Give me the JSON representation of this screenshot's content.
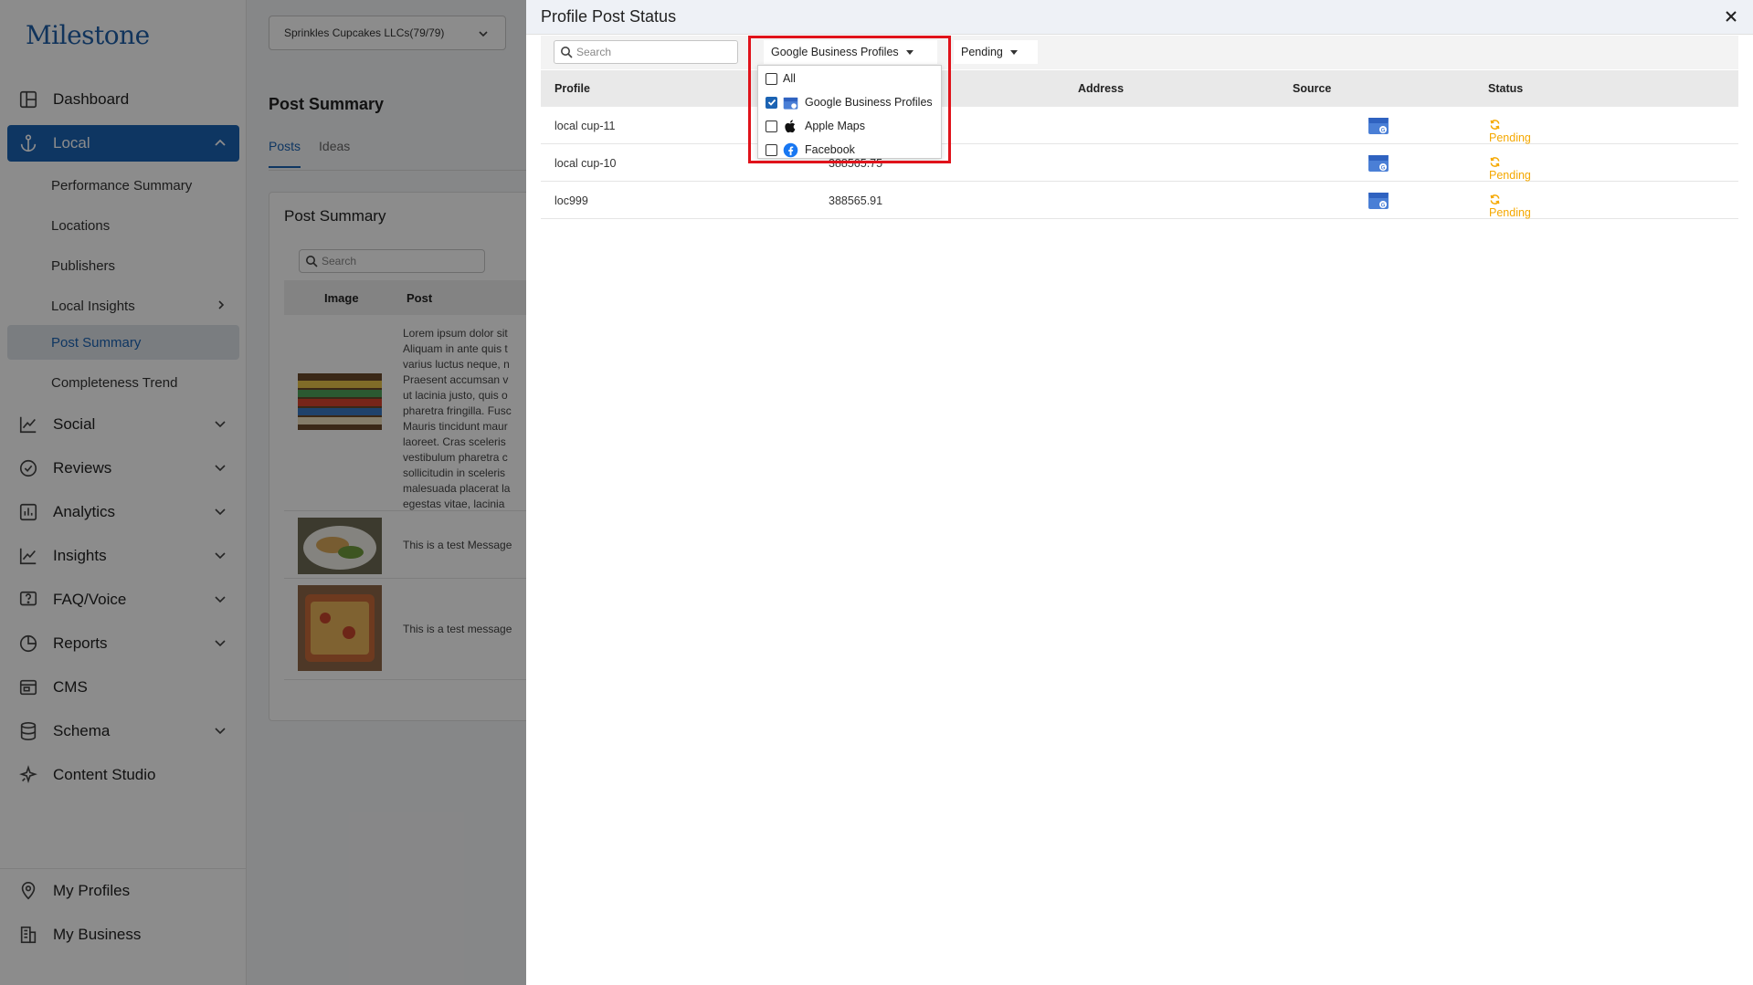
{
  "app": {
    "logo": "Milestone"
  },
  "sidebar": {
    "items": [
      {
        "label": "Dashboard",
        "icon": "dashboard-icon"
      },
      {
        "label": "Local",
        "icon": "anchor-icon"
      },
      {
        "label": "Social",
        "icon": "chart-line-icon"
      },
      {
        "label": "Reviews",
        "icon": "check-circle-icon"
      },
      {
        "label": "Analytics",
        "icon": "bar-chart-icon"
      },
      {
        "label": "Insights",
        "icon": "chart-line-icon"
      },
      {
        "label": "FAQ/Voice",
        "icon": "question-icon"
      },
      {
        "label": "Reports",
        "icon": "pie-chart-icon"
      },
      {
        "label": "CMS",
        "icon": "cms-icon"
      },
      {
        "label": "Schema",
        "icon": "database-icon"
      },
      {
        "label": "Content Studio",
        "icon": "sparkle-icon"
      }
    ],
    "local_sub": [
      {
        "label": "Performance Summary"
      },
      {
        "label": "Locations"
      },
      {
        "label": "Publishers"
      },
      {
        "label": "Local Insights"
      },
      {
        "label": "Post Summary"
      },
      {
        "label": "Completeness Trend"
      }
    ],
    "bottom": [
      {
        "label": "My Profiles",
        "icon": "location-pin-icon"
      },
      {
        "label": "My Business",
        "icon": "building-icon"
      }
    ]
  },
  "main": {
    "org_select": "Sprinkles Cupcakes LLCs(79/79)",
    "page_title": "Post Summary",
    "tabs": [
      {
        "label": "Posts"
      },
      {
        "label": "Ideas"
      }
    ],
    "card_title": "Post Summary",
    "search_placeholder": "Search",
    "columns": {
      "image": "Image",
      "post": "Post"
    },
    "posts": [
      {
        "text": "Lorem ipsum dolor sit\nAliquam in ante quis t\nvarius luctus neque, n\nPraesent accumsan v\nut lacinia justo, quis o\npharetra fringilla. Fusc\nMauris tincidunt maur\nlaoreet. Cras sceleris\nvestibulum pharetra c\nsollicitudin in sceleris\nmalesuada placerat la\negestas vitae, lacinia"
      },
      {
        "text": "This is a test Message"
      },
      {
        "text": "This is a test message"
      }
    ]
  },
  "drawer": {
    "title": "Profile Post Status",
    "search_placeholder": "Search",
    "source_filter": "Google Business Profiles",
    "status_filter": "Pending",
    "columns": {
      "profile": "Profile",
      "address": "Address",
      "source": "Source",
      "status": "Status"
    },
    "rows": [
      {
        "profile": "local cup-11",
        "address": "",
        "source_icon": "google-business-icon",
        "status": "Pending"
      },
      {
        "profile": "local cup-10",
        "address": "388565.75",
        "source_icon": "google-business-icon",
        "status": "Pending"
      },
      {
        "profile": "loc999",
        "address": "388565.91",
        "source_icon": "google-business-icon",
        "status": "Pending"
      }
    ],
    "source_options": [
      {
        "label": "All",
        "checked": false,
        "icon": ""
      },
      {
        "label": "Google Business Profiles",
        "checked": true,
        "icon": "google-business-icon"
      },
      {
        "label": "Apple Maps",
        "checked": false,
        "icon": "apple-icon"
      },
      {
        "label": "Facebook",
        "checked": false,
        "icon": "facebook-icon"
      }
    ]
  },
  "colors": {
    "accent": "#1b63b3",
    "pending": "#f5a800",
    "highlight": "#e0121a"
  }
}
